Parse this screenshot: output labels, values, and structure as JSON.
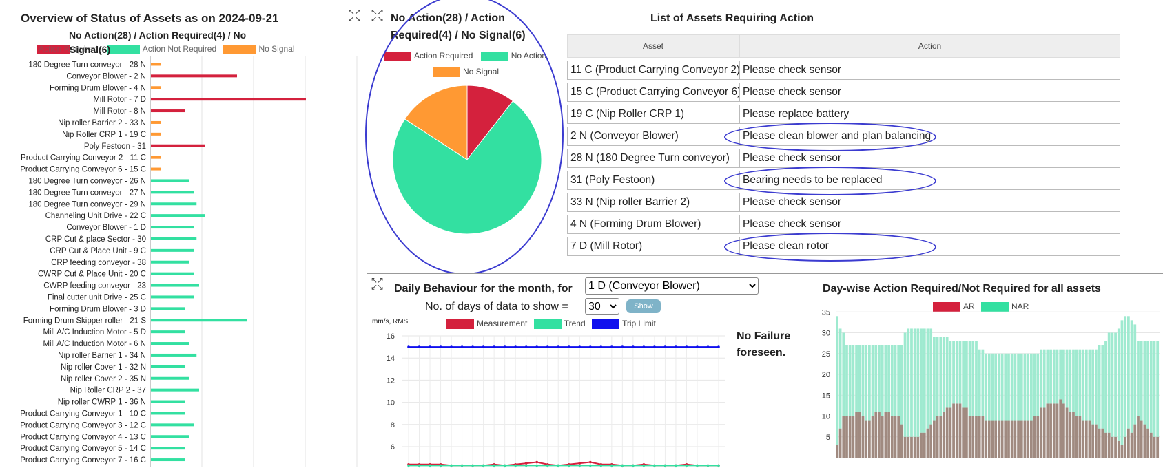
{
  "colors": {
    "action_required": "#d4213d",
    "action_not_required": "#33e0a1",
    "no_signal": "#ff9933",
    "trip_limit": "#1010ee",
    "annotation": "#3b3bd0"
  },
  "overview": {
    "title": "Overview of Status of Assets as on 2024-09-21",
    "subtitle1": "No Action(28) / Action Required(4) / No",
    "subtitle2": "Signal(6)",
    "legend": {
      "action_required": "Action Required",
      "action_not_required": "Action Not Required",
      "no_signal": "No Signal"
    },
    "expand_icon": "expand-icon",
    "chart_data": {
      "type": "bar",
      "orientation": "horizontal",
      "categories": [
        "180 Degree Turn conveyor - 28 N",
        "Conveyor Blower - 2 N",
        "Forming Drum Blower - 4 N",
        "Mill Rotor - 7 D",
        "Mill Rotor - 8 N",
        "Nip roller Barrier 2 - 33 N",
        "Nip Roller CRP 1 - 19 C",
        "Poly Festoon - 31",
        "Product Carrying Conveyor 2 - 11 C",
        "Product Carrying Conveyor 6 - 15 C",
        "180 Degree Turn conveyor - 26 N",
        "180 Degree Turn conveyor - 27 N",
        "180 Degree Turn conveyor - 29 N",
        "Channeling Unit Drive - 22 C",
        "Conveyor Blower - 1 D",
        "CRP Cut & place Sector - 30",
        "CRP Cut & Place Unit - 9 C",
        "CRP feeding conveyor - 38",
        "CWRP Cut & Place Unit - 20 C",
        "CWRP feeding conveyor - 23",
        "Final cutter unit Drive - 25 C",
        "Forming Drum Blower - 3 D",
        "Forming Drum Skipper roller - 21 S",
        "Mill A/C Induction Motor - 5 D",
        "Mill A/C Induction Motor - 6 N",
        "Nip roller Barrier 1 - 34 N",
        "Nip roller Cover 1 - 32 N",
        "Nip roller Cover 2 - 35 N",
        "Nip Roller CRP 2 - 37",
        "Nip roller CWRP 1 - 36 N",
        "Product Carrying Conveyor 1 - 10 C",
        "Product Carrying Conveyor 3 - 12 C",
        "Product Carrying Conveyor 4 - 13 C",
        "Product Carrying Conveyor 5 - 14 C",
        "Product Carrying Conveyor 7 - 16 C"
      ],
      "values": [
        0.12,
        1.0,
        0.12,
        1.8,
        0.4,
        0.12,
        0.12,
        0.63,
        0.12,
        0.12,
        0.44,
        0.5,
        0.53,
        0.63,
        0.5,
        0.53,
        0.5,
        0.44,
        0.5,
        0.56,
        0.5,
        0.4,
        1.12,
        0.4,
        0.44,
        0.53,
        0.4,
        0.44,
        0.56,
        0.4,
        0.4,
        0.5,
        0.44,
        0.4,
        0.4
      ],
      "status": [
        "NS",
        "AR",
        "NS",
        "AR",
        "AR",
        "NS",
        "NS",
        "AR",
        "NS",
        "NS",
        "NAR",
        "NAR",
        "NAR",
        "NAR",
        "NAR",
        "NAR",
        "NAR",
        "NAR",
        "NAR",
        "NAR",
        "NAR",
        "NAR",
        "NAR",
        "NAR",
        "NAR",
        "NAR",
        "NAR",
        "NAR",
        "NAR",
        "NAR",
        "NAR",
        "NAR",
        "NAR",
        "NAR",
        "NAR"
      ],
      "xlim": [
        0,
        2.4
      ]
    }
  },
  "pie": {
    "title1": "No Action(28) / Action",
    "title2": "Required(4) / No Signal(6)",
    "legend": {
      "action_required": "Action Required",
      "no_action": "No Action",
      "no_signal": "No Signal"
    },
    "chart_data": {
      "type": "pie",
      "labels": [
        "Action Required",
        "No Action",
        "No Signal"
      ],
      "values": [
        4,
        28,
        6
      ]
    }
  },
  "assets_table": {
    "title": "List of Assets Requiring Action",
    "headers": [
      "Asset",
      "Action"
    ],
    "rows": [
      {
        "asset": "11 C (Product Carrying Conveyor 2)",
        "action": "Please check sensor",
        "circled": false
      },
      {
        "asset": "15 C (Product Carrying Conveyor 6)",
        "action": "Please check sensor",
        "circled": false
      },
      {
        "asset": "19 C (Nip Roller CRP 1)",
        "action": "Please replace battery",
        "circled": false
      },
      {
        "asset": "2 N (Conveyor Blower)",
        "action": "Please clean blower and plan balancing",
        "circled": true
      },
      {
        "asset": "28 N (180 Degree Turn conveyor)",
        "action": "Please check sensor",
        "circled": false
      },
      {
        "asset": "31  (Poly Festoon)",
        "action": "Bearing needs to be replaced",
        "circled": true
      },
      {
        "asset": "33 N (Nip roller Barrier 2)",
        "action": "Please check sensor",
        "circled": false
      },
      {
        "asset": "4 N (Forming Drum Blower)",
        "action": "Please check sensor",
        "circled": false
      },
      {
        "asset": "7 D (Mill Rotor)",
        "action": "Please clean rotor",
        "circled": true
      }
    ]
  },
  "daily": {
    "title": "Daily Behaviour for the month, for",
    "asset_selected": "1 D (Conveyor Blower)",
    "days_label": "No. of days of data to show =",
    "days_selected": "30",
    "show_button": "Show",
    "unit_label": "mm/s, RMS",
    "legend": {
      "measurement": "Measurement",
      "trend": "Trend",
      "trip_limit": "Trip Limit"
    },
    "message_line1": "No Failure",
    "message_line2": "foreseen.",
    "chart_data": {
      "type": "line",
      "x": [
        1,
        2,
        3,
        4,
        5,
        6,
        7,
        8,
        9,
        10,
        11,
        12,
        13,
        14,
        15,
        16,
        17,
        18,
        19,
        20,
        21,
        22,
        23,
        24,
        25,
        26,
        27,
        28,
        29,
        30
      ],
      "series": [
        {
          "name": "Measurement",
          "values": [
            4.4,
            4.4,
            4.4,
            4.4,
            4.3,
            4.3,
            4.3,
            4.3,
            4.4,
            4.3,
            4.4,
            4.5,
            4.6,
            4.4,
            4.3,
            4.4,
            4.5,
            4.6,
            4.4,
            4.4,
            4.3,
            4.3,
            4.4,
            4.3,
            4.3,
            4.3,
            4.4,
            4.3,
            4.3,
            4.3
          ]
        },
        {
          "name": "Trend",
          "values": [
            4.3,
            4.3,
            4.3,
            4.3,
            4.3,
            4.3,
            4.3,
            4.3,
            4.3,
            4.3,
            4.3,
            4.3,
            4.3,
            4.3,
            4.3,
            4.3,
            4.3,
            4.3,
            4.3,
            4.3,
            4.3,
            4.3,
            4.3,
            4.3,
            4.3,
            4.3,
            4.3,
            4.3,
            4.3,
            4.3
          ]
        },
        {
          "name": "Trip Limit",
          "values": [
            15,
            15,
            15,
            15,
            15,
            15,
            15,
            15,
            15,
            15,
            15,
            15,
            15,
            15,
            15,
            15,
            15,
            15,
            15,
            15,
            15,
            15,
            15,
            15,
            15,
            15,
            15,
            15,
            15,
            15
          ]
        }
      ],
      "yticks": [
        6,
        8,
        10,
        12,
        14,
        16
      ],
      "ylim": [
        4,
        16.5
      ]
    }
  },
  "daywise": {
    "title": "Day-wise Action Required/Not Required for all assets",
    "legend": {
      "ar": "AR",
      "nar": "NAR"
    },
    "chart_data": {
      "type": "bar",
      "stacked": true,
      "yticks": [
        5,
        10,
        15,
        20,
        25,
        30,
        35
      ],
      "ylim": [
        0,
        35
      ],
      "series": [
        {
          "name": "AR",
          "values": [
            3,
            7,
            10,
            10,
            10,
            10,
            11,
            11,
            10,
            9,
            9,
            10,
            11,
            11,
            10,
            11,
            11,
            10,
            10,
            10,
            8,
            5,
            5,
            5,
            5,
            5,
            6,
            6,
            7,
            8,
            9,
            10,
            10,
            11,
            12,
            12,
            13,
            13,
            13,
            12,
            12,
            10,
            10,
            10,
            10,
            10,
            9,
            9,
            9,
            9,
            9,
            9,
            9,
            9,
            9,
            9,
            9,
            9,
            9,
            9,
            9,
            10,
            10,
            12,
            12,
            13,
            13,
            13,
            13,
            14,
            13,
            12,
            11,
            11,
            10,
            10,
            9,
            9,
            9,
            8,
            8,
            7,
            7,
            6,
            6,
            5,
            5,
            4,
            3,
            5,
            7,
            6,
            8,
            10,
            9,
            8,
            7,
            6,
            5,
            5
          ]
        },
        {
          "name": "NAR",
          "values": [
            31,
            24,
            20,
            17,
            17,
            17,
            16,
            16,
            17,
            18,
            18,
            17,
            16,
            16,
            17,
            16,
            16,
            17,
            17,
            17,
            19,
            25,
            26,
            26,
            26,
            26,
            25,
            25,
            24,
            23,
            20,
            19,
            19,
            18,
            17,
            16,
            15,
            15,
            15,
            16,
            16,
            18,
            18,
            18,
            16,
            16,
            16,
            16,
            16,
            16,
            16,
            16,
            16,
            16,
            16,
            16,
            16,
            16,
            16,
            16,
            16,
            15,
            15,
            14,
            14,
            13,
            13,
            13,
            13,
            12,
            13,
            14,
            15,
            15,
            16,
            16,
            17,
            17,
            17,
            18,
            18,
            20,
            20,
            22,
            24,
            25,
            25,
            27,
            30,
            29,
            27,
            27,
            24,
            18,
            19,
            20,
            21,
            22,
            23,
            23
          ]
        }
      ]
    }
  }
}
